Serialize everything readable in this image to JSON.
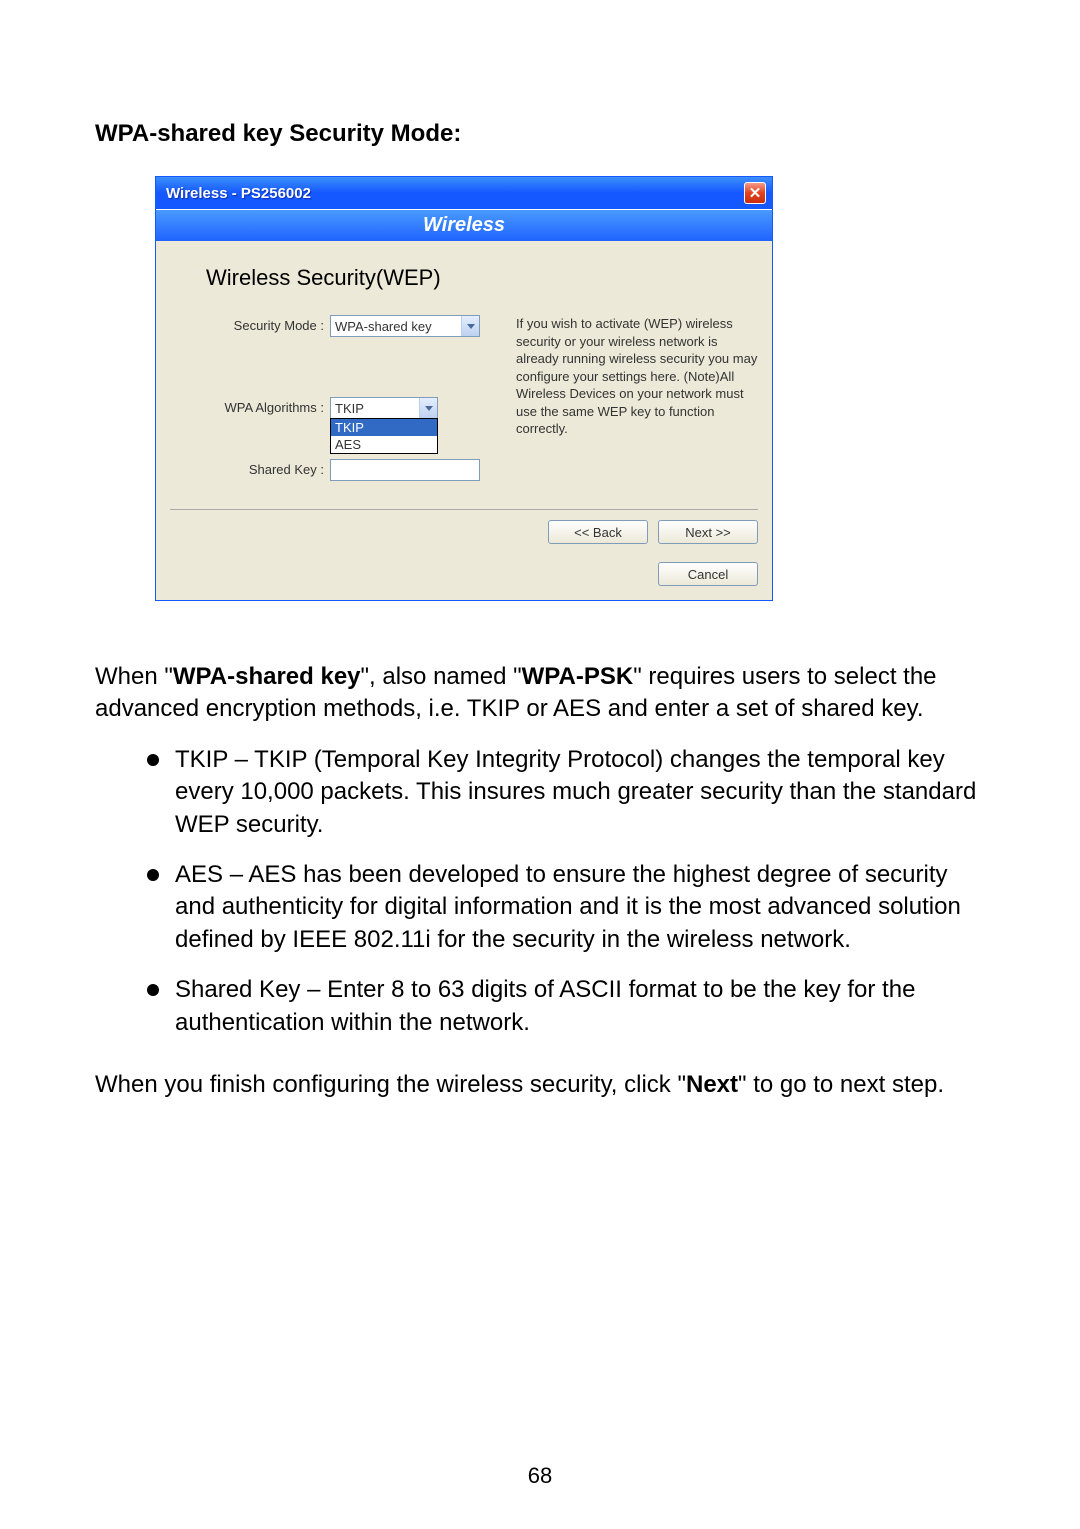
{
  "heading": "WPA-shared key Security Mode:",
  "dialog": {
    "title": "Wireless - PS256002",
    "section": "Wireless",
    "inner_heading": "Wireless Security(WEP)",
    "security_mode_label": "Security Mode :",
    "security_mode_value": "WPA-shared key",
    "wpa_algo_label": "WPA Algorithms :",
    "wpa_algo_value": "TKIP",
    "wpa_algo_options": [
      "TKIP",
      "AES"
    ],
    "shared_key_label": "Shared Key :",
    "help_text": "If you wish to activate (WEP) wireless security or your wireless network is already running wireless security you may configure your settings here. (Note)All Wireless Devices on your network must use the same WEP key to function correctly.",
    "back_btn": "<< Back",
    "next_btn": "Next >>",
    "cancel_btn": "Cancel"
  },
  "paragraph1_parts": {
    "p1": "When \"",
    "b1": "WPA-shared key",
    "p2": "\", also named \"",
    "b2": "WPA-PSK",
    "p3": "\" requires users to select the advanced encryption methods, i.e. TKIP or AES and enter a set of shared key."
  },
  "bullets": [
    "TKIP – TKIP (Temporal Key Integrity Protocol) changes the temporal key every 10,000 packets. This insures much greater security than the standard WEP security.",
    "AES – AES has been developed to ensure the highest degree of security and authenticity for digital information and it is the most advanced solution defined by IEEE 802.11i for the security in the wireless network.",
    "Shared Key – Enter 8 to 63 digits of ASCII format to be the key for the authentication within the network."
  ],
  "paragraph2_parts": {
    "p1": "When you finish configuring the wireless security, click \"",
    "b1": "Next",
    "p2": "\" to go to next step."
  },
  "page_number": "68"
}
